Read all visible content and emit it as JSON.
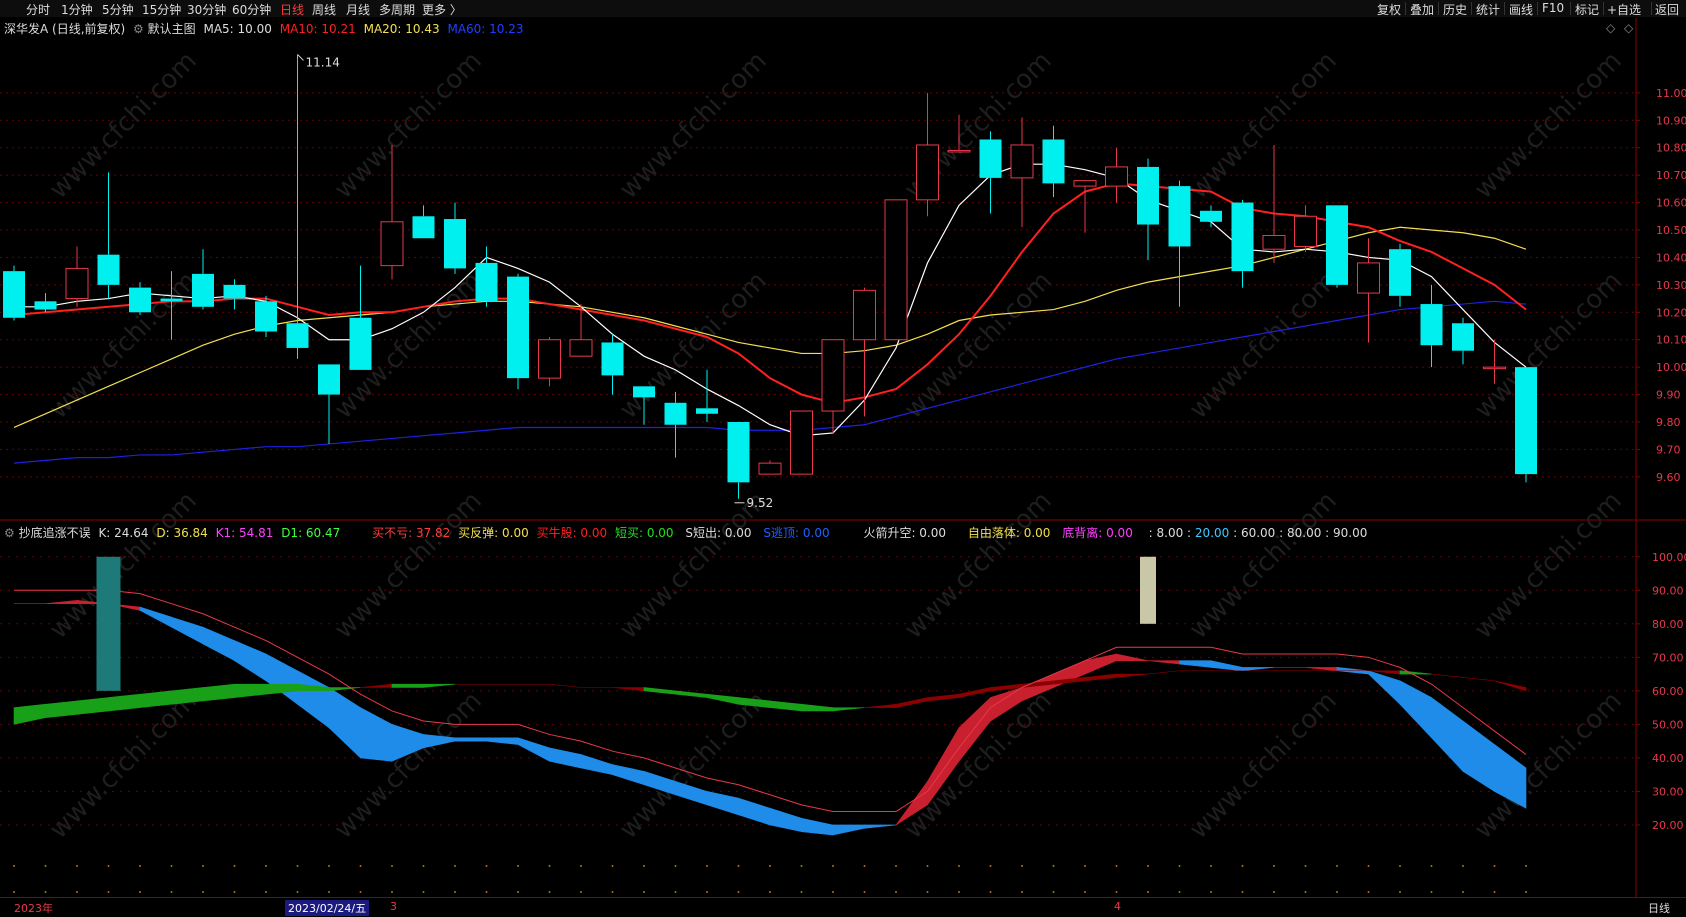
{
  "tabs": [
    "分时",
    "1分钟",
    "5分钟",
    "15分钟",
    "30分钟",
    "60分钟",
    "日线",
    "周线",
    "月线",
    "多周期",
    "更多 〉"
  ],
  "active_tab": "日线",
  "right_tabs": [
    "复权",
    "叠加",
    "历史",
    "统计",
    "画线",
    "F10",
    "+自选",
    "返回"
  ],
  "flag_label": "标记",
  "colors": {
    "up": "#e8384b",
    "down": "#00f0f0",
    "ma5": "#ffffff",
    "ma10": "#ff2020",
    "ma20": "#f0e050",
    "ma60": "#2020e0",
    "grid": "#6b0000"
  },
  "main_legend": {
    "stock": "深华发A (日线,前复权)",
    "chart": "默认主图",
    "ma5": "MA5: 10.00",
    "ma10": "MA10: 10.21",
    "ma20": "MA20: 10.43",
    "ma60": "MA60: 10.23"
  },
  "sub_legend": {
    "name": "抄底追涨不误",
    "k": "K: 24.64",
    "d": "D: 36.84",
    "k1": "K1: 54.81",
    "d1": "D1: 60.47",
    "buy_no_loss": "买不亏: 37.82",
    "buy_rebound": "买反弹: 0.00",
    "buy_bull": "买牛股: 0.00",
    "short_buy": "短买: 0.00",
    "s_short_out": "S短出: 0.00",
    "s_escape": "S逃顶: 0.00",
    "rocket": "火箭升空: 0.00",
    "free_fall": "自由落体: 0.00",
    "divergence": "底背离: 0.00",
    "levels": ": 8.00 :",
    "level20": "20.00",
    "levels_rest": ": 60.00 : 80.00 : 90.00"
  },
  "annotations": {
    "high": "11.14",
    "low": "9.52"
  },
  "footer": {
    "year": "2023年",
    "date": "2023/02/24/五",
    "m3": "3",
    "m4": "4",
    "period": "日线"
  },
  "chart_data": [
    {
      "type": "candlestick",
      "price_axis": {
        "ylim": [
          9.45,
          11.2
        ],
        "ticks": [
          11.0,
          10.9,
          10.8,
          10.7,
          10.6,
          10.5,
          10.4,
          10.3,
          10.2,
          10.1,
          10.0,
          9.9,
          9.8,
          9.7,
          9.6
        ],
        "tick_labels": [
          "11.00",
          "10.90",
          "10.80",
          "10.70",
          "10.60",
          "10.50",
          "10.40",
          "10.30",
          "10.20",
          "10.10",
          "10.00",
          "9.90",
          "9.80",
          "9.70",
          "9.60"
        ]
      },
      "candles": [
        [
          10.35,
          10.18,
          10.37,
          10.17
        ],
        [
          10.24,
          10.21,
          10.27,
          10.2
        ],
        [
          10.25,
          10.36,
          10.44,
          10.22
        ],
        [
          10.41,
          10.3,
          10.71,
          10.25
        ],
        [
          10.29,
          10.2,
          10.31,
          10.19
        ],
        [
          10.25,
          10.24,
          10.35,
          10.1
        ],
        [
          10.34,
          10.22,
          10.43,
          10.21
        ],
        [
          10.3,
          10.25,
          10.32,
          10.21
        ],
        [
          10.24,
          10.13,
          10.26,
          10.11
        ],
        [
          10.16,
          10.07,
          11.14,
          10.03
        ],
        [
          10.01,
          9.9,
          10.01,
          9.72
        ],
        [
          10.18,
          9.99,
          10.37,
          9.99
        ],
        [
          10.37,
          10.53,
          10.81,
          10.32
        ],
        [
          10.55,
          10.47,
          10.59,
          10.47
        ],
        [
          10.54,
          10.36,
          10.6,
          10.34
        ],
        [
          10.38,
          10.24,
          10.44,
          10.22
        ],
        [
          10.33,
          9.96,
          10.34,
          9.92
        ],
        [
          9.96,
          10.1,
          10.11,
          9.93
        ],
        [
          10.04,
          10.1,
          10.23,
          10.04
        ],
        [
          10.09,
          9.97,
          10.12,
          9.9
        ],
        [
          9.93,
          9.89,
          9.93,
          9.79
        ],
        [
          9.87,
          9.79,
          9.91,
          9.67
        ],
        [
          9.85,
          9.83,
          9.99,
          9.8
        ],
        [
          9.8,
          9.58,
          9.8,
          9.52
        ],
        [
          9.61,
          9.65,
          9.66,
          9.61
        ],
        [
          9.61,
          9.84,
          9.84,
          9.61
        ],
        [
          9.84,
          10.1,
          10.1,
          9.76
        ],
        [
          10.1,
          10.28,
          10.29,
          9.82
        ],
        [
          10.1,
          10.61,
          10.61,
          10.1
        ],
        [
          10.61,
          10.81,
          11.0,
          10.55
        ],
        [
          10.79,
          10.79,
          10.92,
          10.79
        ],
        [
          10.83,
          10.69,
          10.86,
          10.56
        ],
        [
          10.69,
          10.81,
          10.91,
          10.51
        ],
        [
          10.83,
          10.67,
          10.88,
          10.62
        ],
        [
          10.66,
          10.68,
          10.68,
          10.49
        ],
        [
          10.66,
          10.73,
          10.8,
          10.6
        ],
        [
          10.73,
          10.52,
          10.76,
          10.39
        ],
        [
          10.66,
          10.44,
          10.68,
          10.22
        ],
        [
          10.57,
          10.53,
          10.59,
          10.51
        ],
        [
          10.6,
          10.35,
          10.61,
          10.29
        ],
        [
          10.43,
          10.48,
          10.81,
          10.38
        ],
        [
          10.44,
          10.55,
          10.59,
          10.42
        ],
        [
          10.59,
          10.3,
          10.59,
          10.29
        ],
        [
          10.27,
          10.38,
          10.47,
          10.09
        ],
        [
          10.43,
          10.26,
          10.45,
          10.22
        ],
        [
          10.23,
          10.08,
          10.3,
          10.0
        ],
        [
          10.16,
          10.06,
          10.18,
          10.01
        ],
        [
          10.0,
          10.0,
          10.1,
          9.94
        ],
        [
          10.0,
          9.61,
          10.0,
          9.58
        ]
      ],
      "ma5": [
        10.22,
        10.22,
        10.24,
        10.25,
        10.27,
        10.26,
        10.25,
        10.26,
        10.24,
        10.18,
        10.1,
        10.1,
        10.14,
        10.2,
        10.29,
        10.4,
        10.36,
        10.31,
        10.22,
        10.12,
        10.04,
        9.99,
        9.92,
        9.86,
        9.79,
        9.75,
        9.76,
        9.88,
        10.07,
        10.38,
        10.59,
        10.7,
        10.74,
        10.74,
        10.72,
        10.69,
        10.61,
        10.57,
        10.53,
        10.43,
        10.42,
        10.43,
        10.42,
        10.4,
        10.39,
        10.33,
        10.21,
        10.09,
        10.0
      ],
      "ma10": [
        10.19,
        10.2,
        10.21,
        10.22,
        10.23,
        10.24,
        10.24,
        10.25,
        10.25,
        10.22,
        10.19,
        10.2,
        10.2,
        10.22,
        10.24,
        10.25,
        10.25,
        10.23,
        10.21,
        10.19,
        10.17,
        10.14,
        10.11,
        10.05,
        9.96,
        9.9,
        9.87,
        9.89,
        9.92,
        10.01,
        10.12,
        10.26,
        10.42,
        10.56,
        10.64,
        10.67,
        10.66,
        10.65,
        10.64,
        10.58,
        10.56,
        10.55,
        10.53,
        10.51,
        10.46,
        10.42,
        10.36,
        10.3,
        10.21
      ],
      "ma20": [
        9.78,
        9.83,
        9.88,
        9.93,
        9.98,
        10.03,
        10.08,
        10.12,
        10.15,
        10.17,
        10.18,
        10.19,
        10.2,
        10.22,
        10.23,
        10.24,
        10.24,
        10.23,
        10.22,
        10.2,
        10.18,
        10.15,
        10.12,
        10.09,
        10.07,
        10.05,
        10.05,
        10.06,
        10.08,
        10.12,
        10.17,
        10.19,
        10.2,
        10.21,
        10.24,
        10.28,
        10.31,
        10.33,
        10.35,
        10.37,
        10.4,
        10.43,
        10.46,
        10.49,
        10.51,
        10.5,
        10.49,
        10.47,
        10.43
      ],
      "ma60": [
        9.65,
        9.66,
        9.67,
        9.67,
        9.68,
        9.68,
        9.69,
        9.7,
        9.71,
        9.71,
        9.72,
        9.73,
        9.74,
        9.75,
        9.76,
        9.77,
        9.78,
        9.78,
        9.78,
        9.78,
        9.78,
        9.78,
        9.78,
        9.77,
        9.77,
        9.77,
        9.78,
        9.79,
        9.82,
        9.85,
        9.88,
        9.91,
        9.94,
        9.97,
        10.0,
        10.03,
        10.05,
        10.07,
        10.09,
        10.11,
        10.13,
        10.15,
        10.17,
        10.19,
        10.21,
        10.22,
        10.23,
        10.24,
        10.23
      ]
    },
    {
      "type": "area",
      "indicator_axis": {
        "ylim": [
          0,
          105
        ],
        "ticks": [
          100,
          90,
          80,
          70,
          60,
          50,
          40,
          30,
          20
        ],
        "tick_labels": [
          "100.00",
          "90.00",
          "80.00",
          "70.00",
          "60.00",
          "50.00",
          "40.00",
          "30.00",
          "20.00"
        ]
      },
      "series": [
        {
          "name": "K",
          "values": [
            86,
            86,
            87,
            86,
            84,
            79,
            74,
            69,
            63,
            56,
            49,
            40,
            39,
            43,
            45,
            45,
            44,
            39,
            37,
            35,
            32,
            29,
            26,
            23,
            20,
            18,
            17,
            19,
            20,
            33,
            49,
            58,
            61,
            65,
            69,
            71,
            69,
            68,
            67,
            66,
            67,
            67,
            66,
            65,
            56,
            46,
            36,
            30,
            25
          ]
        },
        {
          "name": "D",
          "values": [
            86,
            86,
            86,
            86,
            85,
            82,
            79,
            75,
            71,
            66,
            61,
            55,
            50,
            47,
            46,
            46,
            46,
            43,
            41,
            38,
            36,
            33,
            30,
            28,
            25,
            22,
            20,
            20,
            20,
            26,
            39,
            51,
            57,
            61,
            65,
            69,
            69,
            69,
            69,
            67,
            67,
            67,
            67,
            66,
            63,
            58,
            51,
            44,
            37
          ]
        },
        {
          "name": "K1",
          "values": [
            50,
            52,
            53,
            54,
            55,
            56,
            57,
            58,
            59,
            60,
            60,
            61,
            61,
            61,
            62,
            62,
            62,
            62,
            61,
            61,
            60,
            59,
            58,
            56,
            55,
            54,
            54,
            55,
            56,
            58,
            59,
            61,
            62,
            63,
            64,
            65,
            65,
            66,
            66,
            66,
            66,
            66,
            66,
            66,
            65,
            65,
            64,
            63,
            60
          ]
        },
        {
          "name": "D1",
          "values": [
            55,
            56,
            57,
            58,
            59,
            60,
            61,
            62,
            62,
            62,
            61,
            61,
            62,
            62,
            62,
            62,
            62,
            62,
            61,
            61,
            61,
            60,
            59,
            58,
            57,
            56,
            55,
            55,
            55,
            57,
            58,
            60,
            61,
            62,
            63,
            64,
            65,
            66,
            66,
            66,
            66,
            66,
            66,
            66,
            66,
            65,
            64,
            63,
            61
          ]
        }
      ]
    }
  ]
}
